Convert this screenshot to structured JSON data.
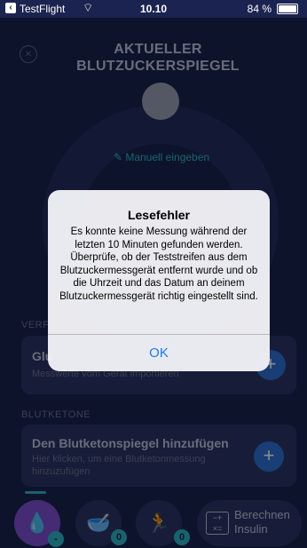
{
  "status_bar": {
    "app_name": "TestFlight",
    "time": "10.10",
    "battery": "84 %"
  },
  "header": {
    "title_line1": "AKTUELLER",
    "title_line2": "BLUTZUCKERSPIEGEL",
    "close_icon": "×"
  },
  "gauge": {
    "manual_entry_label": "Manuell eingeben",
    "manual_entry_icon": "✎"
  },
  "glucose_section": {
    "label": "VERF",
    "card_title": "Glu",
    "card_subtitle": "Messwerte vom Gerät importieren",
    "plus": "+"
  },
  "ketone_section": {
    "label": "BLUTKETONE",
    "card_title": "Den Blutketonspiegel hinzufügen",
    "card_subtitle_line1": "Hier klicken, um eine Blutketonmessung",
    "card_subtitle_line2": "hinzuzufügen",
    "plus": "+"
  },
  "bottom_nav": {
    "drop_icon": "💧",
    "drop_badge": "-",
    "meal_icon": "🥣",
    "meal_badge": "0",
    "activity_icon": "🏃",
    "activity_badge": "0",
    "calc_label_line1": "Berechnen",
    "calc_label_line2": "Insulin",
    "calc_icon_glyph": "−+\n×="
  },
  "alert": {
    "title": "Lesefehler",
    "message": "Es konnte keine Messung während der letzten 10 Minuten gefunden werden. Überprüfe, ob der Teststreifen aus dem Blutzuckermessgerät entfernt wurde und ob die Uhrzeit und das Datum an deinem Blutzuckermessgerät richtig eingestellt sind.",
    "ok_label": "OK"
  },
  "colors": {
    "background": "#1b2450",
    "accent": "#2fb5c9",
    "primary_button": "#2f6fd6",
    "active_tab": "#7c4fd4",
    "alert_button": "#1a7af0"
  }
}
